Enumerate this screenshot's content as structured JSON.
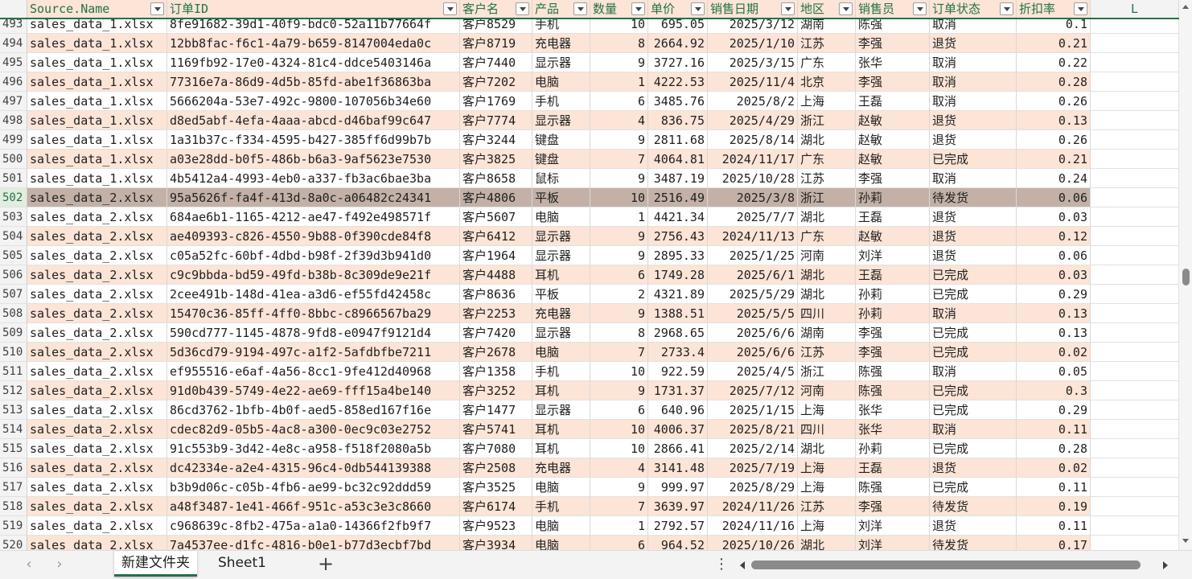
{
  "columns": [
    {
      "label": "Source.Name",
      "filter": true
    },
    {
      "label": "订单ID",
      "filter": true
    },
    {
      "label": "客户名",
      "filter": true
    },
    {
      "label": "产品",
      "filter": true
    },
    {
      "label": "数量",
      "filter": true
    },
    {
      "label": "单价",
      "filter": true
    },
    {
      "label": "销售日期",
      "filter": true
    },
    {
      "label": "地区",
      "filter": true
    },
    {
      "label": "销售员",
      "filter": true
    },
    {
      "label": "订单状态",
      "filter": true
    },
    {
      "label": "折扣率",
      "filter": true
    },
    {
      "label": "L",
      "filter": false
    }
  ],
  "selected_row": "502",
  "rows": [
    [
      "493",
      "sales_data_1.xlsx",
      "8fe91682-39d1-40f9-bdc0-52a11b77664f",
      "客户8529",
      "手机",
      "10",
      "695.05",
      "2025/3/12",
      "湖南",
      "陈强",
      "取消",
      "0.1"
    ],
    [
      "494",
      "sales_data_1.xlsx",
      "12bb8fac-f6c1-4a79-b659-8147004eda0c",
      "客户8719",
      "充电器",
      "8",
      "2664.92",
      "2025/1/10",
      "江苏",
      "李强",
      "退货",
      "0.21"
    ],
    [
      "495",
      "sales_data_1.xlsx",
      "1169fb92-17e0-4324-81c4-ddce5403146a",
      "客户7440",
      "显示器",
      "9",
      "3727.16",
      "2025/3/15",
      "广东",
      "张华",
      "取消",
      "0.22"
    ],
    [
      "496",
      "sales_data_1.xlsx",
      "77316e7a-86d9-4d5b-85fd-abe1f36863ba",
      "客户7202",
      "电脑",
      "1",
      "4222.53",
      "2025/11/4",
      "北京",
      "李强",
      "取消",
      "0.28"
    ],
    [
      "497",
      "sales_data_1.xlsx",
      "5666204a-53e7-492c-9800-107056b34e60",
      "客户1769",
      "手机",
      "6",
      "3485.76",
      "2025/8/2",
      "上海",
      "王磊",
      "取消",
      "0.26"
    ],
    [
      "498",
      "sales_data_1.xlsx",
      "d8ed5abf-4efa-4aaa-abcd-d46baf99c647",
      "客户7774",
      "显示器",
      "4",
      "836.75",
      "2025/4/29",
      "浙江",
      "赵敏",
      "退货",
      "0.13"
    ],
    [
      "499",
      "sales_data_1.xlsx",
      "1a31b37c-f334-4595-b427-385ff6d99b7b",
      "客户3244",
      "键盘",
      "9",
      "2811.68",
      "2025/8/14",
      "湖北",
      "赵敏",
      "退货",
      "0.26"
    ],
    [
      "500",
      "sales_data_1.xlsx",
      "a03e28dd-b0f5-486b-b6a3-9af5623e7530",
      "客户3825",
      "键盘",
      "7",
      "4064.81",
      "2024/11/17",
      "广东",
      "赵敏",
      "已完成",
      "0.21"
    ],
    [
      "501",
      "sales_data_1.xlsx",
      "4b5412a4-4993-4eb0-a337-fb3ac6bae3ba",
      "客户8658",
      "鼠标",
      "9",
      "3487.19",
      "2025/10/28",
      "江苏",
      "李强",
      "取消",
      "0.24"
    ],
    [
      "502",
      "sales_data_2.xlsx",
      "95a5626f-fa4f-413d-8a0c-a06482c24341",
      "客户4806",
      "平板",
      "10",
      "2516.49",
      "2025/3/8",
      "浙江",
      "孙莉",
      "待发货",
      "0.06"
    ],
    [
      "503",
      "sales_data_2.xlsx",
      "684ae6b1-1165-4212-ae47-f492e498571f",
      "客户5607",
      "电脑",
      "1",
      "4421.34",
      "2025/7/7",
      "湖北",
      "王磊",
      "退货",
      "0.03"
    ],
    [
      "504",
      "sales_data_2.xlsx",
      "ae409393-c826-4550-9b88-0f390cde84f8",
      "客户6412",
      "显示器",
      "9",
      "2756.43",
      "2024/11/13",
      "广东",
      "赵敏",
      "退货",
      "0.12"
    ],
    [
      "505",
      "sales_data_2.xlsx",
      "c05a52fc-60bf-4dbd-b98f-2f39d3b941d0",
      "客户1964",
      "显示器",
      "9",
      "2895.33",
      "2025/1/25",
      "河南",
      "刘洋",
      "退货",
      "0.06"
    ],
    [
      "506",
      "sales_data_2.xlsx",
      "c9c9bbda-bd59-49fd-b38b-8c309de9e21f",
      "客户4488",
      "耳机",
      "6",
      "1749.28",
      "2025/6/1",
      "湖北",
      "王磊",
      "已完成",
      "0.03"
    ],
    [
      "507",
      "sales_data_2.xlsx",
      "2cee491b-148d-41ea-a3d6-ef55fd42458c",
      "客户8636",
      "平板",
      "2",
      "4321.89",
      "2025/5/29",
      "湖北",
      "孙莉",
      "已完成",
      "0.29"
    ],
    [
      "508",
      "sales_data_2.xlsx",
      "15470c36-85ff-4ff0-8bbc-c8966567ba29",
      "客户2253",
      "充电器",
      "9",
      "1388.51",
      "2025/5/5",
      "四川",
      "孙莉",
      "取消",
      "0.13"
    ],
    [
      "509",
      "sales_data_2.xlsx",
      "590cd777-1145-4878-9fd8-e0947f9121d4",
      "客户7420",
      "显示器",
      "8",
      "2968.65",
      "2025/6/6",
      "湖南",
      "李强",
      "已完成",
      "0.13"
    ],
    [
      "510",
      "sales_data_2.xlsx",
      "5d36cd79-9194-497c-a1f2-5afdbfbe7211",
      "客户2678",
      "电脑",
      "7",
      "2733.4",
      "2025/6/6",
      "江苏",
      "李强",
      "已完成",
      "0.02"
    ],
    [
      "511",
      "sales_data_2.xlsx",
      "ef955516-e6af-4a56-8cc1-9fe412d40968",
      "客户1358",
      "手机",
      "10",
      "922.59",
      "2025/4/5",
      "浙江",
      "陈强",
      "取消",
      "0.05"
    ],
    [
      "512",
      "sales_data_2.xlsx",
      "91d0b439-5749-4e22-ae69-fff15a4be140",
      "客户3252",
      "耳机",
      "9",
      "1731.37",
      "2025/7/12",
      "河南",
      "陈强",
      "已完成",
      "0.3"
    ],
    [
      "513",
      "sales_data_2.xlsx",
      "86cd3762-1bfb-4b0f-aed5-858ed167f16e",
      "客户1477",
      "显示器",
      "6",
      "640.96",
      "2025/1/15",
      "上海",
      "张华",
      "已完成",
      "0.29"
    ],
    [
      "514",
      "sales_data_2.xlsx",
      "cdec82d9-05b5-4ac8-a300-0ec9c03e2752",
      "客户5741",
      "耳机",
      "10",
      "4006.37",
      "2025/8/21",
      "四川",
      "张华",
      "取消",
      "0.11"
    ],
    [
      "515",
      "sales_data_2.xlsx",
      "91c553b9-3d42-4e8c-a958-f518f2080a5b",
      "客户7080",
      "耳机",
      "10",
      "2866.41",
      "2025/2/14",
      "湖北",
      "孙莉",
      "已完成",
      "0.28"
    ],
    [
      "516",
      "sales_data_2.xlsx",
      "dc42334e-a2e4-4315-96c4-0db544139388",
      "客户2508",
      "充电器",
      "4",
      "3141.48",
      "2025/7/19",
      "上海",
      "王磊",
      "退货",
      "0.02"
    ],
    [
      "517",
      "sales_data_2.xlsx",
      "b3b9d06c-c05b-4fb6-ae99-bc32c92ddd59",
      "客户3525",
      "电脑",
      "9",
      "999.97",
      "2025/8/29",
      "上海",
      "陈强",
      "已完成",
      "0.11"
    ],
    [
      "518",
      "sales_data_2.xlsx",
      "a48f3487-1e41-466f-951c-a53c3e3c8660",
      "客户6174",
      "手机",
      "7",
      "3639.97",
      "2024/11/26",
      "江苏",
      "李强",
      "待发货",
      "0.19"
    ],
    [
      "519",
      "sales_data_2.xlsx",
      "c968639c-8fb2-475a-a1a0-14366f2fb9f7",
      "客户9523",
      "电脑",
      "1",
      "2792.57",
      "2024/11/16",
      "上海",
      "刘洋",
      "退货",
      "0.11"
    ],
    [
      "520",
      "sales_data_2.xlsx",
      "7a4537ee-d1fc-4816-b0e1-b77d3ecbf7bd",
      "客户3934",
      "电脑",
      "6",
      "964.52",
      "2025/10/26",
      "湖北",
      "刘洋",
      "待发货",
      "0.17"
    ]
  ],
  "sheet_tabs": [
    {
      "label": "新建文件夹",
      "active": true
    },
    {
      "label": "Sheet1",
      "active": false
    }
  ],
  "footer": {
    "prev_icon": "chevron-left-icon",
    "next_icon": "chevron-right-icon",
    "add_label": "+",
    "more_label": "⋮"
  },
  "colors": {
    "accent": "#217346",
    "band": "#fce4d6",
    "selected": "#c3b1a7"
  }
}
